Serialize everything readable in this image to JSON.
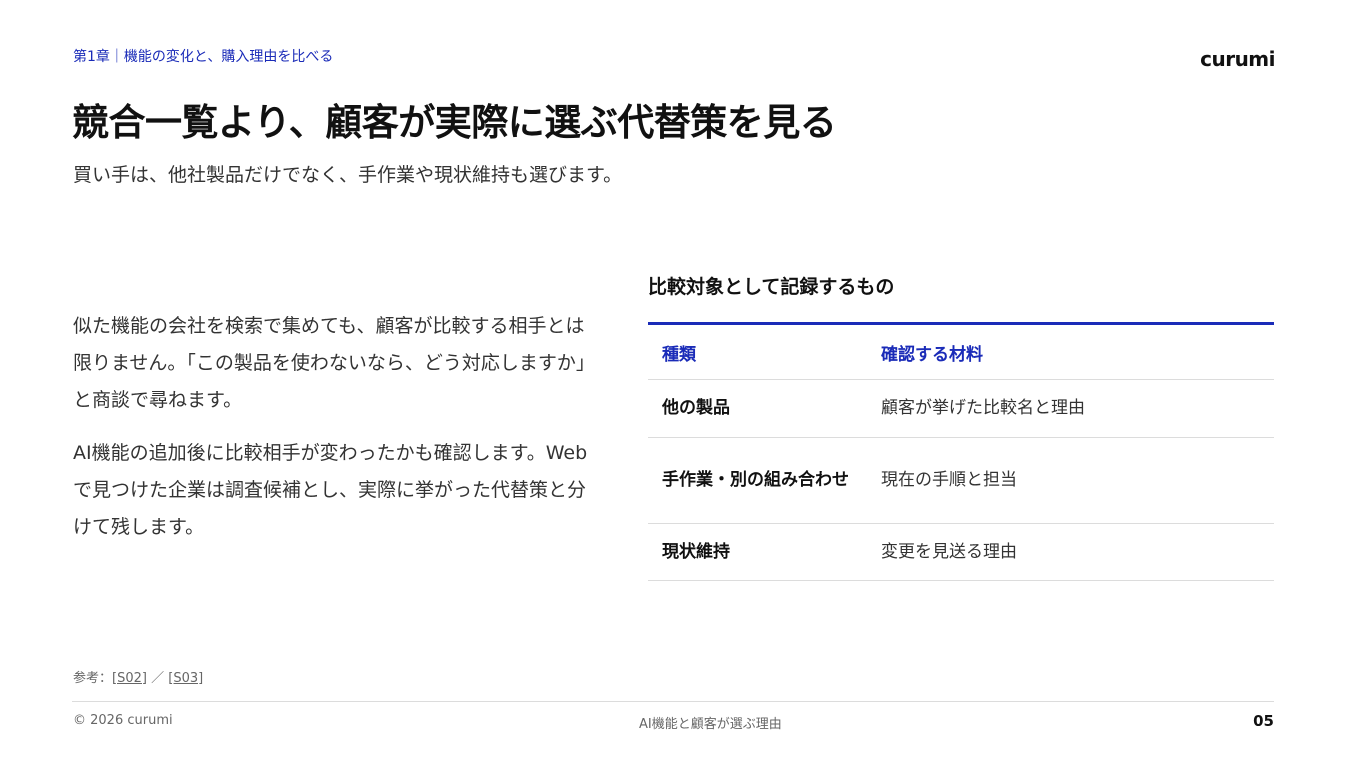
{
  "header": {
    "chapter": "第1章｜機能の変化と、購入理由を比べる",
    "logo": "curumi"
  },
  "title": "競合一覧より、顧客が実際に選ぶ代替策を見る",
  "subtitle": "買い手は、他社製品だけでなく、手作業や現状維持も選びます。",
  "body": {
    "paragraphs": [
      "似た機能の会社を検索で集めても、顧客が比較する相手とは限りません。「この製品を使わないなら、どう対応しますか」と商談で尋ねます。",
      "AI機能の追加後に比較相手が変わったかも確認します。Webで見つけた企業は調査候補とし、実際に挙がった代替策と分けて残します。"
    ]
  },
  "table": {
    "heading": "比較対象として記録するもの",
    "columns": [
      "種類",
      "確認する材料"
    ],
    "rows": [
      {
        "kind": "他の製品",
        "material": "顧客が挙げた比較名と理由"
      },
      {
        "kind": "手作業・別の組み合わせ",
        "material": "現在の手順と担当"
      },
      {
        "kind": "現状維持",
        "material": "変更を見送る理由"
      }
    ]
  },
  "references": {
    "label": "参考：",
    "links": [
      "[S02]",
      "[S03]"
    ],
    "separator": "／"
  },
  "footer": {
    "copyright": "© 2026 curumi",
    "center": "AI機能と顧客が選ぶ理由",
    "page": "05"
  },
  "colors": {
    "accent": "#1a2bb8",
    "text": "#333333",
    "rule": "#dcdcdc"
  }
}
